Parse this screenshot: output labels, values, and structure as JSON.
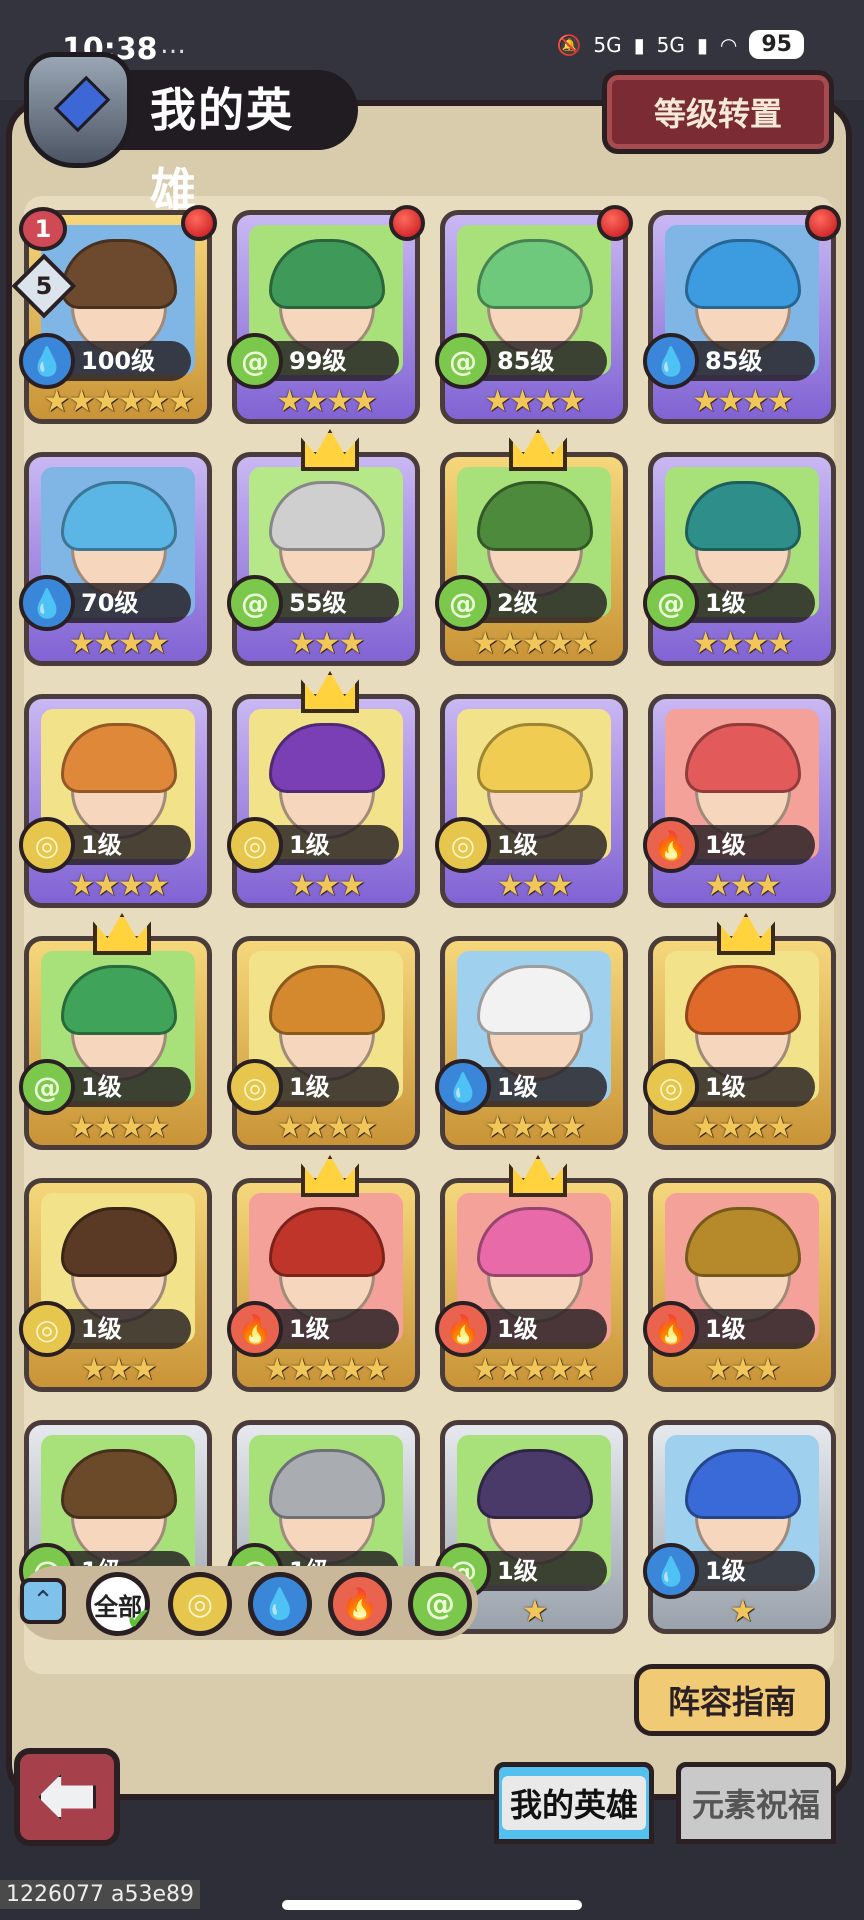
{
  "status": {
    "time": "10:38",
    "extra": "…",
    "net1": "5G",
    "net2": "5G",
    "battery": "95"
  },
  "header": {
    "title": "我的英雄",
    "reset_button": "等级转置"
  },
  "badges": {
    "rank_top": "1",
    "rank_diamond": "5"
  },
  "heroes": [
    {
      "level": "100级",
      "stars": "★★★★★★",
      "element": "water",
      "rarity": "gold",
      "crown": false,
      "dot": true
    },
    {
      "level": "99级",
      "stars": "★★★★",
      "element": "wind",
      "rarity": "purple",
      "crown": false,
      "dot": true
    },
    {
      "level": "85级",
      "stars": "★★★★",
      "element": "wind",
      "rarity": "purple",
      "crown": false,
      "dot": true
    },
    {
      "level": "85级",
      "stars": "★★★★",
      "element": "water",
      "rarity": "purple",
      "crown": false,
      "dot": true
    },
    {
      "level": "70级",
      "stars": "★★★★",
      "element": "water",
      "rarity": "purple",
      "crown": false,
      "dot": false
    },
    {
      "level": "55级",
      "stars": "★★★",
      "element": "wind",
      "rarity": "purple",
      "crown": true,
      "dot": false
    },
    {
      "level": "2级",
      "stars": "★★★★★",
      "element": "wind",
      "rarity": "gold",
      "crown": true,
      "dot": false
    },
    {
      "level": "1级",
      "stars": "★★★★",
      "element": "wind",
      "rarity": "purple",
      "crown": false,
      "dot": false
    },
    {
      "level": "1级",
      "stars": "★★★★",
      "element": "earth",
      "rarity": "purple",
      "crown": false,
      "dot": false
    },
    {
      "level": "1级",
      "stars": "★★★",
      "element": "earth",
      "rarity": "purple",
      "crown": true,
      "dot": false
    },
    {
      "level": "1级",
      "stars": "★★★",
      "element": "earth",
      "rarity": "purple",
      "crown": false,
      "dot": false
    },
    {
      "level": "1级",
      "stars": "★★★",
      "element": "fire",
      "rarity": "purple",
      "crown": false,
      "dot": false
    },
    {
      "level": "1级",
      "stars": "★★★★",
      "element": "wind",
      "rarity": "gold",
      "crown": true,
      "dot": false
    },
    {
      "level": "1级",
      "stars": "★★★★",
      "element": "earth",
      "rarity": "gold",
      "crown": false,
      "dot": false
    },
    {
      "level": "1级",
      "stars": "★★★★",
      "element": "water",
      "rarity": "gold",
      "crown": false,
      "dot": false
    },
    {
      "level": "1级",
      "stars": "★★★★",
      "element": "earth",
      "rarity": "gold",
      "crown": true,
      "dot": false
    },
    {
      "level": "1级",
      "stars": "★★★",
      "element": "earth",
      "rarity": "gold",
      "crown": false,
      "dot": false
    },
    {
      "level": "1级",
      "stars": "★★★★★",
      "element": "fire",
      "rarity": "gold",
      "crown": true,
      "dot": false
    },
    {
      "level": "1级",
      "stars": "★★★★★",
      "element": "fire",
      "rarity": "gold",
      "crown": true,
      "dot": false
    },
    {
      "level": "1级",
      "stars": "★★★",
      "element": "fire",
      "rarity": "gold",
      "crown": false,
      "dot": false
    },
    {
      "level": "1级",
      "stars": "★★★★★",
      "element": "wind",
      "rarity": "silver",
      "crown": false,
      "dot": false
    },
    {
      "level": "1级",
      "stars": "★",
      "element": "wind",
      "rarity": "silver",
      "crown": false,
      "dot": false
    },
    {
      "level": "1级",
      "stars": "★",
      "element": "wind",
      "rarity": "silver",
      "crown": false,
      "dot": false
    },
    {
      "level": "1级",
      "stars": "★",
      "element": "water",
      "rarity": "silver",
      "crown": false,
      "dot": false
    }
  ],
  "filters": {
    "all_label": "全部",
    "elements": [
      "earth",
      "water",
      "fire",
      "wind"
    ]
  },
  "guide_button": "阵容指南",
  "tabs": {
    "my_heroes": "我的英雄",
    "element_blessing": "元素祝福"
  },
  "watermark": "1226077 a53e89",
  "colors": {
    "water": "#3a86d8",
    "wind": "#7cc84c",
    "earth": "#e6c64c",
    "fire": "#e9634f",
    "portrait_bg": [
      "#7fb6e6",
      "#a8e07a",
      "#a8e07a",
      "#7fb6e6",
      "#7fb6e6",
      "#b6e88a",
      "#a8e07a",
      "#a8e07a",
      "#f2e28a",
      "#f2e28a",
      "#f2e28a",
      "#f4a19a",
      "#a8e07a",
      "#f2e28a",
      "#9fd1ef",
      "#f2e28a",
      "#f2e28a",
      "#f4a19a",
      "#f4a19a",
      "#f4a19a",
      "#a8e07a",
      "#a8e07a",
      "#a8e07a",
      "#9fd1ef"
    ],
    "hair": [
      "#6d4a2e",
      "#3f9a5a",
      "#6ec97c",
      "#3d9be0",
      "#5bb5e5",
      "#cfcfcf",
      "#4e8a3c",
      "#2e8f8a",
      "#e0883a",
      "#7a3fb5",
      "#f0cd52",
      "#e25a5a",
      "#3fa35a",
      "#d5892e",
      "#f2f2f2",
      "#e06a2a",
      "#5a3a24",
      "#c0352a",
      "#e86aa8",
      "#b68a2a",
      "#6b4a2a",
      "#a9adb2",
      "#4a3a6a",
      "#3a6ad8"
    ]
  }
}
